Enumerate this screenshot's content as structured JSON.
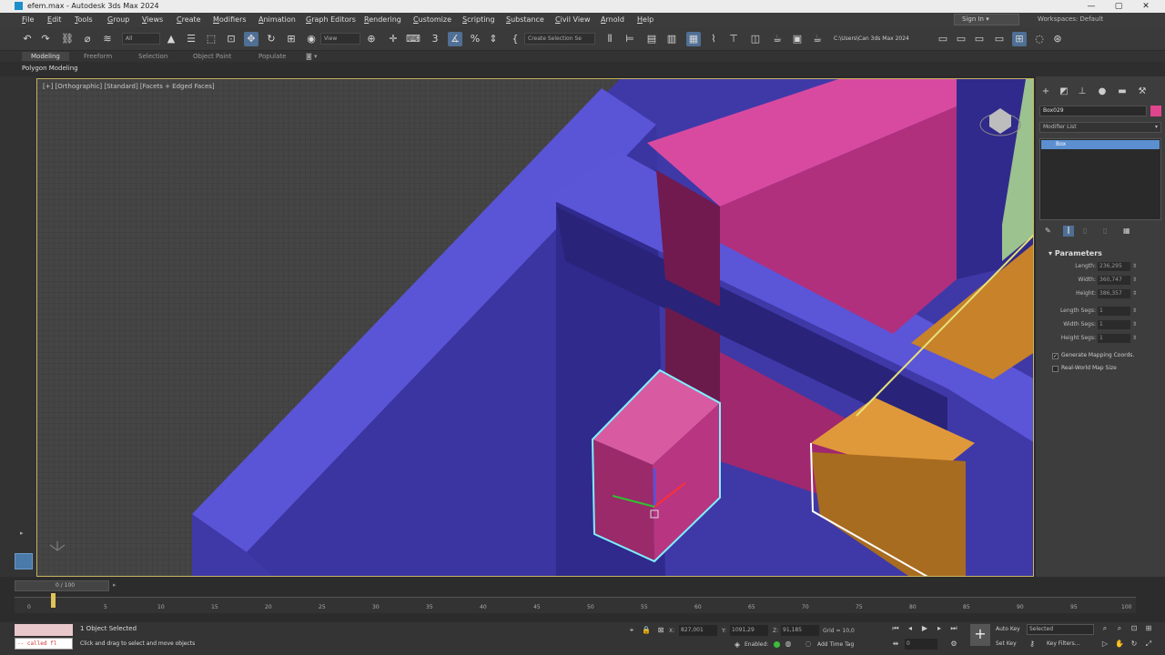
{
  "window": {
    "title": "efem.max - Autodesk 3ds Max 2024",
    "minimize": "—",
    "maximize": "▢",
    "close": "✕"
  },
  "menu": {
    "items": [
      "File",
      "Edit",
      "Tools",
      "Group",
      "Views",
      "Create",
      "Modifiers",
      "Animation",
      "Graph Editors",
      "Rendering",
      "Customize",
      "Scripting",
      "Substance",
      "Civil View",
      "Arnold",
      "Help"
    ],
    "sign_in": "Sign In",
    "workspaces_label": "Workspaces:",
    "workspaces_value": "Default"
  },
  "toolbar": {
    "filter_value": "All",
    "view_value": "View",
    "selection_set_placeholder": "Create Selection Se",
    "path_value": "C:\\Users\\Can 3ds Max 2024"
  },
  "ribbon": {
    "tabs": [
      "Modeling",
      "Freeform",
      "Selection",
      "Object Paint",
      "Populate"
    ],
    "active_tab": "Modeling",
    "sub_label": "Polygon Modeling"
  },
  "viewport": {
    "label": "[+] [Orthographic] [Standard] [Facets + Edged Faces]"
  },
  "command_panel": {
    "object_name": "Box029",
    "object_color": "#e0458f",
    "modifier_list": "Modifier List",
    "stack_item": "Box",
    "parameters_title": "Parameters",
    "params": [
      {
        "label": "Length:",
        "value": "236,295"
      },
      {
        "label": "Width:",
        "value": "360,747"
      },
      {
        "label": "Height:",
        "value": "386,357"
      },
      {
        "label": "Length Segs:",
        "value": "1"
      },
      {
        "label": "Width Segs:",
        "value": "1"
      },
      {
        "label": "Height Segs:",
        "value": "1"
      }
    ],
    "generate_mapping": "Generate Mapping Coords.",
    "real_world": "Real-World Map Size"
  },
  "timeline": {
    "slider_label": "0 / 100",
    "ticks": [
      "0",
      "5",
      "10",
      "15",
      "20",
      "25",
      "30",
      "35",
      "40",
      "45",
      "50",
      "55",
      "60",
      "65",
      "70",
      "75",
      "80",
      "85",
      "90",
      "95",
      "100"
    ]
  },
  "status": {
    "maxscript_text": "-- called fl",
    "selected_text": "1 Object Selected",
    "prompt_text": "Click and drag to select and move objects",
    "x_label": "X:",
    "x_value": "827,001",
    "y_label": "Y:",
    "y_value": "1091,29",
    "z_label": "Z:",
    "z_value": "91,185",
    "grid": "Grid = 10,0",
    "enabled": "Enabled:",
    "add_time_tag": "Add Time Tag",
    "auto_key": "Auto Key",
    "selected_dd": "Selected",
    "set_key": "Set Key",
    "key_filters": "Key Filters...",
    "frame_value": "0"
  }
}
